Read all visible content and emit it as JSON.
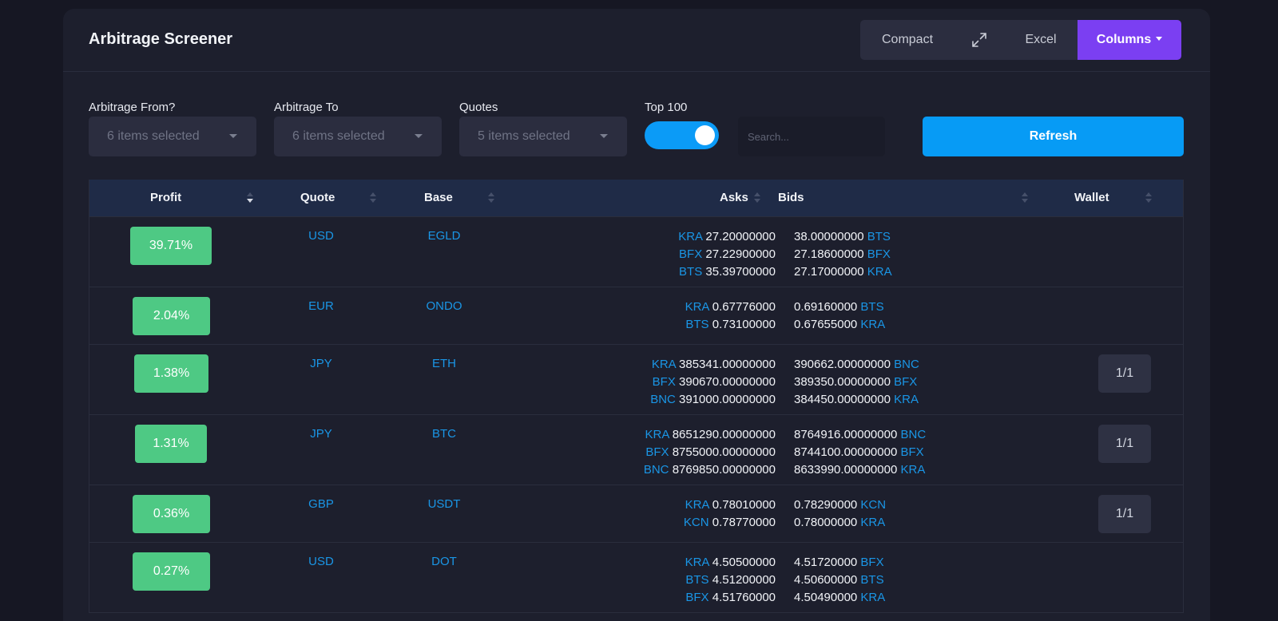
{
  "header": {
    "title": "Arbitrage Screener",
    "compact_label": "Compact",
    "excel_label": "Excel",
    "columns_label": "Columns"
  },
  "filters": {
    "from_label": "Arbitrage From?",
    "from_value": "6 items selected",
    "to_label": "Arbitrage To",
    "to_value": "6 items selected",
    "quotes_label": "Quotes",
    "quotes_value": "5 items selected",
    "top_label": "Top 100",
    "top_enabled": true,
    "search_placeholder": "Search...",
    "refresh_label": "Refresh"
  },
  "colors": {
    "accent_purple": "#7b3ff2",
    "accent_blue": "#079bf5",
    "profit_green": "#4ec984",
    "link_blue": "#1a96e6"
  },
  "table": {
    "columns": {
      "profit": "Profit",
      "quote": "Quote",
      "base": "Base",
      "asks": "Asks",
      "bids": "Bids",
      "wallet": "Wallet"
    },
    "rows": [
      {
        "profit": "39.71%",
        "quote": "USD",
        "base": "EGLD",
        "asks": [
          {
            "exchange": "KRA",
            "price": "27.20000000"
          },
          {
            "exchange": "BFX",
            "price": "27.22900000"
          },
          {
            "exchange": "BTS",
            "price": "35.39700000"
          }
        ],
        "bids": [
          {
            "price": "38.00000000",
            "exchange": "BTS"
          },
          {
            "price": "27.18600000",
            "exchange": "BFX"
          },
          {
            "price": "27.17000000",
            "exchange": "KRA"
          }
        ],
        "wallet": ""
      },
      {
        "profit": "2.04%",
        "quote": "EUR",
        "base": "ONDO",
        "asks": [
          {
            "exchange": "KRA",
            "price": "0.67776000"
          },
          {
            "exchange": "BTS",
            "price": "0.73100000"
          }
        ],
        "bids": [
          {
            "price": "0.69160000",
            "exchange": "BTS"
          },
          {
            "price": "0.67655000",
            "exchange": "KRA"
          }
        ],
        "wallet": ""
      },
      {
        "profit": "1.38%",
        "quote": "JPY",
        "base": "ETH",
        "asks": [
          {
            "exchange": "KRA",
            "price": "385341.00000000"
          },
          {
            "exchange": "BFX",
            "price": "390670.00000000"
          },
          {
            "exchange": "BNC",
            "price": "391000.00000000"
          }
        ],
        "bids": [
          {
            "price": "390662.00000000",
            "exchange": "BNC"
          },
          {
            "price": "389350.00000000",
            "exchange": "BFX"
          },
          {
            "price": "384450.00000000",
            "exchange": "KRA"
          }
        ],
        "wallet": "1/1"
      },
      {
        "profit": "1.31%",
        "quote": "JPY",
        "base": "BTC",
        "asks": [
          {
            "exchange": "KRA",
            "price": "8651290.00000000"
          },
          {
            "exchange": "BFX",
            "price": "8755000.00000000"
          },
          {
            "exchange": "BNC",
            "price": "8769850.00000000"
          }
        ],
        "bids": [
          {
            "price": "8764916.00000000",
            "exchange": "BNC"
          },
          {
            "price": "8744100.00000000",
            "exchange": "BFX"
          },
          {
            "price": "8633990.00000000",
            "exchange": "KRA"
          }
        ],
        "wallet": "1/1"
      },
      {
        "profit": "0.36%",
        "quote": "GBP",
        "base": "USDT",
        "asks": [
          {
            "exchange": "KRA",
            "price": "0.78010000"
          },
          {
            "exchange": "KCN",
            "price": "0.78770000"
          }
        ],
        "bids": [
          {
            "price": "0.78290000",
            "exchange": "KCN"
          },
          {
            "price": "0.78000000",
            "exchange": "KRA"
          }
        ],
        "wallet": "1/1"
      },
      {
        "profit": "0.27%",
        "quote": "USD",
        "base": "DOT",
        "asks": [
          {
            "exchange": "KRA",
            "price": "4.50500000"
          },
          {
            "exchange": "BTS",
            "price": "4.51200000"
          },
          {
            "exchange": "BFX",
            "price": "4.51760000"
          }
        ],
        "bids": [
          {
            "price": "4.51720000",
            "exchange": "BFX"
          },
          {
            "price": "4.50600000",
            "exchange": "BTS"
          },
          {
            "price": "4.50490000",
            "exchange": "KRA"
          }
        ],
        "wallet": ""
      }
    ]
  }
}
